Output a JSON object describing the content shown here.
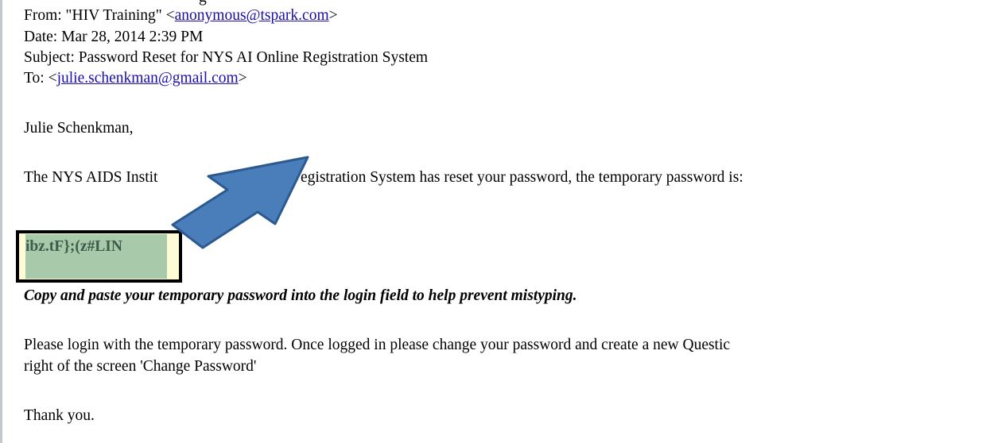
{
  "header": {
    "clipped_top_text": "g",
    "from_label": "From: \"HIV Training\" <",
    "from_email": "anonymous@tspark.com",
    "from_suffix": ">",
    "date": "Date: Mar 28, 2014 2:39 PM",
    "subject": "Subject: Password Reset for NYS AI Online Registration System",
    "to_label": "To: <",
    "to_email": "julie.schenkman@gmail.com",
    "to_suffix": ">"
  },
  "body": {
    "greeting": "Julie Schenkman,",
    "intro_left": "The NYS AIDS Instit",
    "intro_right": "egistration System has reset your password, the temporary password is:",
    "temp_password": "ibz.tF};(z#LIN",
    "copy_note": "Copy and paste your temporary password into the login field to help prevent mistyping.",
    "instructions_line1": "Please login with the temporary password. Once logged in please change your password and create a new Questic",
    "instructions_line2": "right of the screen 'Change Password'",
    "closing": "Thank you."
  },
  "colors": {
    "link": "#1a0dab",
    "arrow_fill": "#4a7ebb",
    "arrow_stroke": "#2c5a8f",
    "highlight_box_bg": "#fffbd5",
    "highlight_fill": "#a8c9aa",
    "password_text": "#3c5d4a"
  },
  "annotation": {
    "arrow_icon": "arrow-pointing-down-left-icon"
  }
}
